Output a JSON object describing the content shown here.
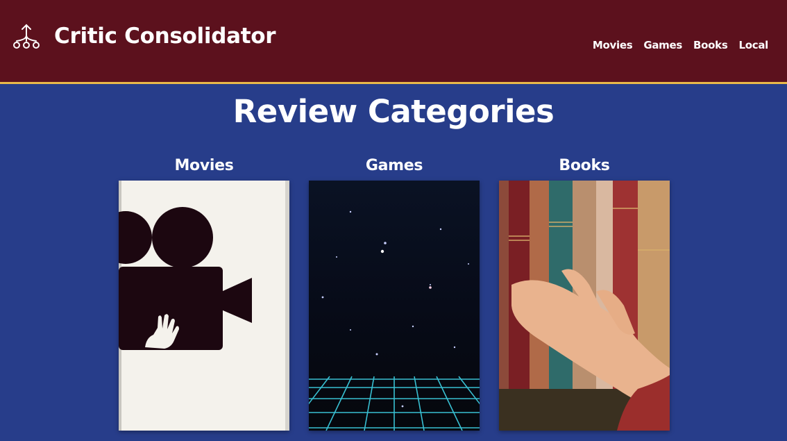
{
  "header": {
    "site_title": "Critic Consolidator",
    "logo_icon": "network-tree-icon",
    "nav": [
      {
        "label": "Movies"
      },
      {
        "label": "Games"
      },
      {
        "label": "Books"
      },
      {
        "label": "Local"
      }
    ]
  },
  "main": {
    "title": "Review Categories",
    "categories": [
      {
        "label": "Movies",
        "image": "movie-camera-illustration"
      },
      {
        "label": "Games",
        "image": "retro-grid-starfield"
      },
      {
        "label": "Books",
        "image": "hand-on-bookshelf"
      }
    ]
  },
  "colors": {
    "header_bg": "#5c111d",
    "accent_border": "#e9b94a",
    "page_bg": "#273d8a"
  }
}
